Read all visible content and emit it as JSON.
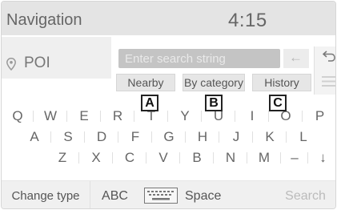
{
  "header": {
    "title": "Navigation",
    "clock": "4:15"
  },
  "search_mode": {
    "label": "POI",
    "icon": "map-pin-icon"
  },
  "search_input": {
    "placeholder": "Enter search string"
  },
  "tabs": [
    "Nearby",
    "By category",
    "History"
  ],
  "callouts": [
    "A",
    "B",
    "C"
  ],
  "keyboard": {
    "rows": [
      [
        "Q",
        "W",
        "E",
        "R",
        "T",
        "Y",
        "U",
        "I",
        "O",
        "P"
      ],
      [
        "A",
        "S",
        "D",
        "F",
        "G",
        "H",
        "J",
        "K",
        "L"
      ],
      [
        "Z",
        "X",
        "C",
        "V",
        "B",
        "N",
        "M",
        "–"
      ]
    ]
  },
  "bottom_bar": {
    "change_type": "Change type",
    "abc": "ABC",
    "space": "Space",
    "search": "Search"
  },
  "icons": {
    "backspace": "←",
    "back": "back-arrow-icon",
    "list": "list-icon",
    "down": "↓",
    "keyboard": "keyboard-icon"
  }
}
